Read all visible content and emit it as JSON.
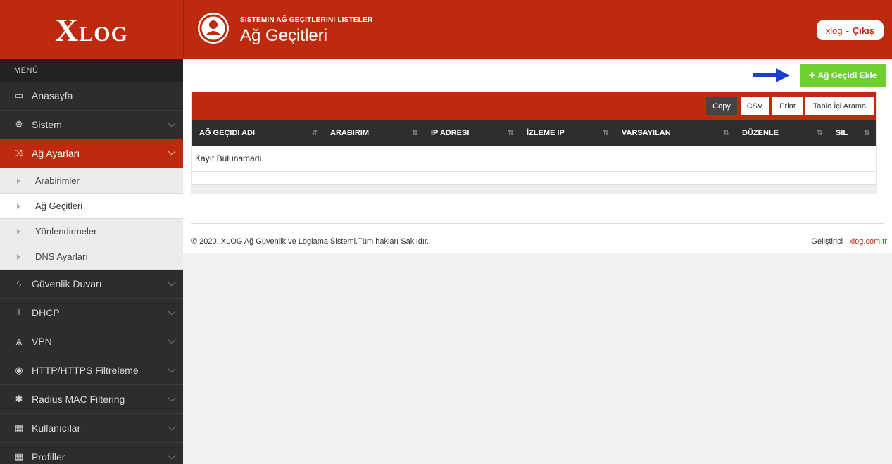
{
  "brand": {
    "logo_big": "X",
    "logo_small": "LOG"
  },
  "sidebar": {
    "menu_title": "MENÜ",
    "items": [
      {
        "label": "Anasayfa",
        "icon": "laptop-icon"
      },
      {
        "label": "Sistem",
        "icon": "gears-icon"
      },
      {
        "label": "Ağ Ayarları",
        "icon": "shuffle-icon"
      },
      {
        "label": "Güvenlik Duvarı",
        "icon": "bolt-icon"
      },
      {
        "label": "DHCP",
        "icon": "sitemap-icon"
      },
      {
        "label": "VPN",
        "icon": "road-icon"
      },
      {
        "label": "HTTP/HTTPS Filtreleme",
        "icon": "eye-slash-icon"
      },
      {
        "label": "Radius MAC Filtering",
        "icon": "asterisk-icon"
      },
      {
        "label": "Kullanıcılar",
        "icon": "grid-icon"
      },
      {
        "label": "Profiller",
        "icon": "grid-icon"
      }
    ],
    "sub_items": [
      {
        "label": "Arabirimler"
      },
      {
        "label": "Ağ Geçitleri"
      },
      {
        "label": "Yönlendirmeler"
      },
      {
        "label": "DNS Ayarları"
      }
    ]
  },
  "header": {
    "subtitle": "SISTEMIN AĞ GEÇITLERINI LISTELER",
    "title": "Ağ Geçitleri",
    "user": "xlog",
    "separator": "-",
    "logout": "Çıkış"
  },
  "actions": {
    "add_label": "✚ Ağ Geçidi Ekle"
  },
  "table": {
    "buttons": [
      "Copy",
      "CSV",
      "Print",
      "Tablo İçi Arama"
    ],
    "columns": [
      "AĞ GEÇIDI ADI",
      "ARABIRIM",
      "IP ADRESI",
      "İZLEME IP",
      "VARSAYILAN",
      "DÜZENLE",
      "SIL"
    ],
    "empty_text": "Kayıt Bulunamadı"
  },
  "footer": {
    "copyright": "© 2020. XLOG Ağ Güvenlik ve Loglama Sistemi.Tüm hakları Saklıdır.",
    "dev_label": "Geliştirici :",
    "dev_link": "xlog.com.tr"
  },
  "colors": {
    "brand": "#bd2a0e",
    "sidebar": "#2b2b2b",
    "add_button": "#6ccf2f",
    "arrow": "#1a3fd1"
  }
}
